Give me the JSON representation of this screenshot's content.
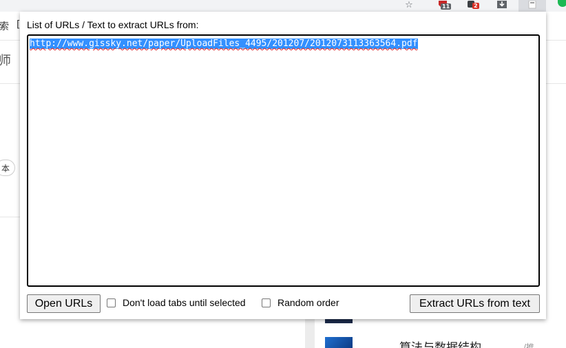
{
  "toolbar": {
    "icons": [
      {
        "name": "bookmark-star-icon",
        "glyph": "☆"
      },
      {
        "name": "extension-adblock-icon",
        "badge": "11",
        "badge_color": "#5f6368"
      },
      {
        "name": "extension-counter-icon",
        "badge": "2",
        "badge_color": "#d93025"
      },
      {
        "name": "download-icon",
        "glyph": "⤓"
      },
      {
        "name": "extension-open-multiple-urls-icon",
        "glyph": "▯"
      }
    ],
    "accent": "#1db954"
  },
  "background": {
    "left_glyphs": [
      "索",
      "[",
      "师",
      "本"
    ],
    "bottom_text": "算法与数据结构",
    "bottom_tag": "/推"
  },
  "popup": {
    "label": "List of URLs / Text to extract URLs from:",
    "textarea_value": "http://www.gissky.net/paper/UploadFiles_4495/201207/2012073113363564.pdf",
    "selection_color": "#3390ff",
    "spellcheck_color": "#e02020",
    "open_button": "Open URLs",
    "lazy_load_label": "Don't load tabs until selected",
    "lazy_load_checked": false,
    "random_order_label": "Random order",
    "random_order_checked": false,
    "extract_button": "Extract URLs from text"
  }
}
